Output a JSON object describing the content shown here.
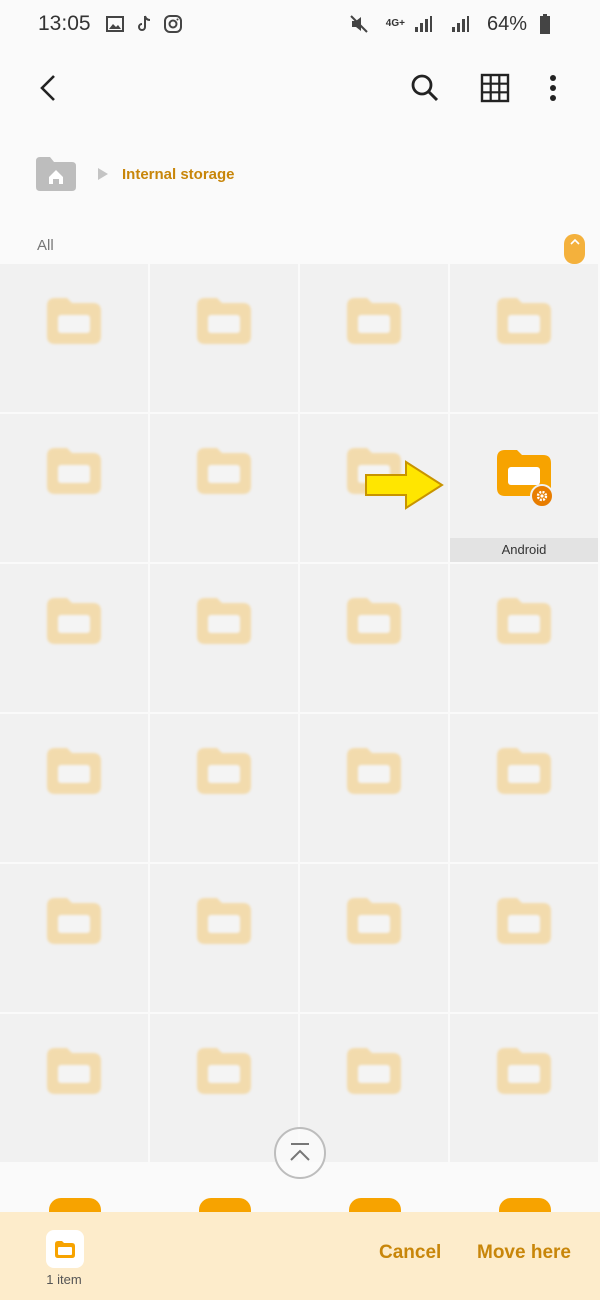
{
  "status_bar": {
    "time": "13:05",
    "network": "4G+",
    "battery": "64%"
  },
  "app_bar": {
    "back_icon": "back-arrow-icon",
    "actions": [
      "search-icon",
      "grid-view-icon",
      "more-options-icon"
    ]
  },
  "breadcrumb": {
    "home_icon": "home-icon",
    "path": [
      "Internal storage"
    ]
  },
  "section_label": "All",
  "folders": [
    {
      "name": "",
      "active": false
    },
    {
      "name": "",
      "active": false
    },
    {
      "name": "",
      "active": false
    },
    {
      "name": "",
      "active": false
    },
    {
      "name": "",
      "active": false
    },
    {
      "name": "",
      "active": false
    },
    {
      "name": "",
      "active": false
    },
    {
      "name": "Android",
      "active": true
    },
    {
      "name": "",
      "active": false
    },
    {
      "name": "",
      "active": false
    },
    {
      "name": "",
      "active": false
    },
    {
      "name": "",
      "active": false
    },
    {
      "name": "",
      "active": false
    },
    {
      "name": "",
      "active": false
    },
    {
      "name": "",
      "active": false
    },
    {
      "name": "",
      "active": false
    },
    {
      "name": "",
      "active": false
    },
    {
      "name": "",
      "active": false
    },
    {
      "name": "",
      "active": false
    },
    {
      "name": "",
      "active": false
    },
    {
      "name": "",
      "active": false
    },
    {
      "name": "",
      "active": false
    },
    {
      "name": "",
      "active": false
    },
    {
      "name": "",
      "active": false
    }
  ],
  "bottom_bar": {
    "selection_count": "1 item",
    "cancel_label": "Cancel",
    "move_label": "Move here"
  },
  "colors": {
    "accent": "#c8860a",
    "folder": "#f7a300",
    "bottom_bar_bg": "#fdeccb"
  }
}
